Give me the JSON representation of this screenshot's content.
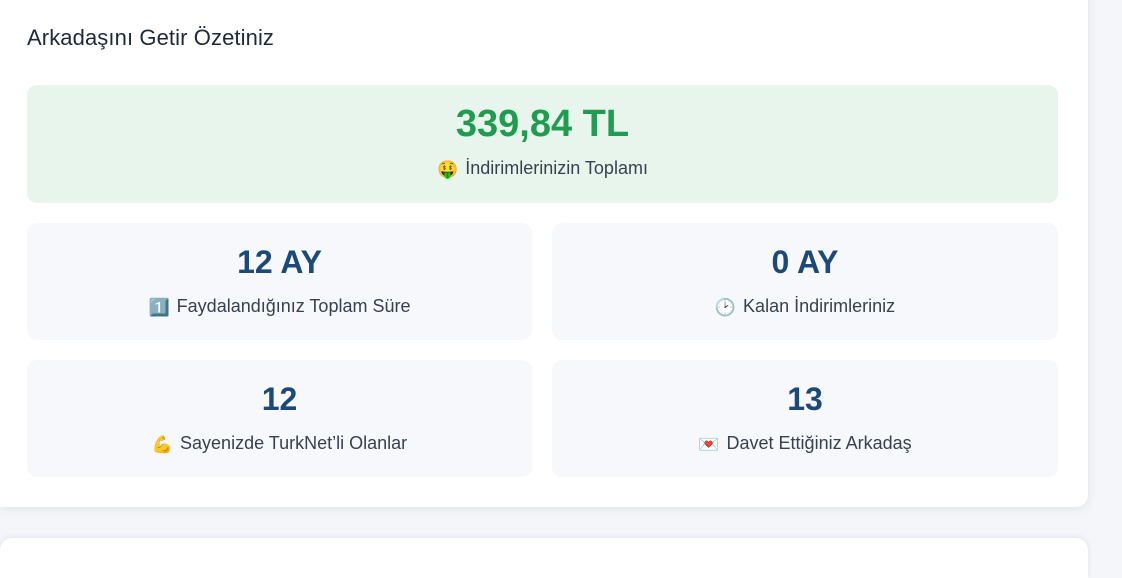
{
  "summary": {
    "title": "Arkadaşını Getir Özetiniz",
    "total": {
      "value": "339,84 TL",
      "icon": "🤑",
      "label": "İndirimlerinizin Toplamı"
    },
    "stats": [
      {
        "value": "12 AY",
        "icon": "1️⃣",
        "label": "Faydalandığınız Toplam Süre"
      },
      {
        "value": "0 AY",
        "icon": "🕑",
        "label": "Kalan İndirimleriniz"
      },
      {
        "value": "12",
        "icon": "💪",
        "label": "Sayenizde TurkNet’li Olanlar"
      },
      {
        "value": "13",
        "icon": "💌",
        "label": "Davet Ettiğiniz Arkadaş"
      }
    ]
  },
  "colors": {
    "total_value": "#1f9c4f",
    "stat_value": "#1b4a7a",
    "total_bg": "#e8f5ec",
    "stat_bg": "#f6f8fb"
  }
}
